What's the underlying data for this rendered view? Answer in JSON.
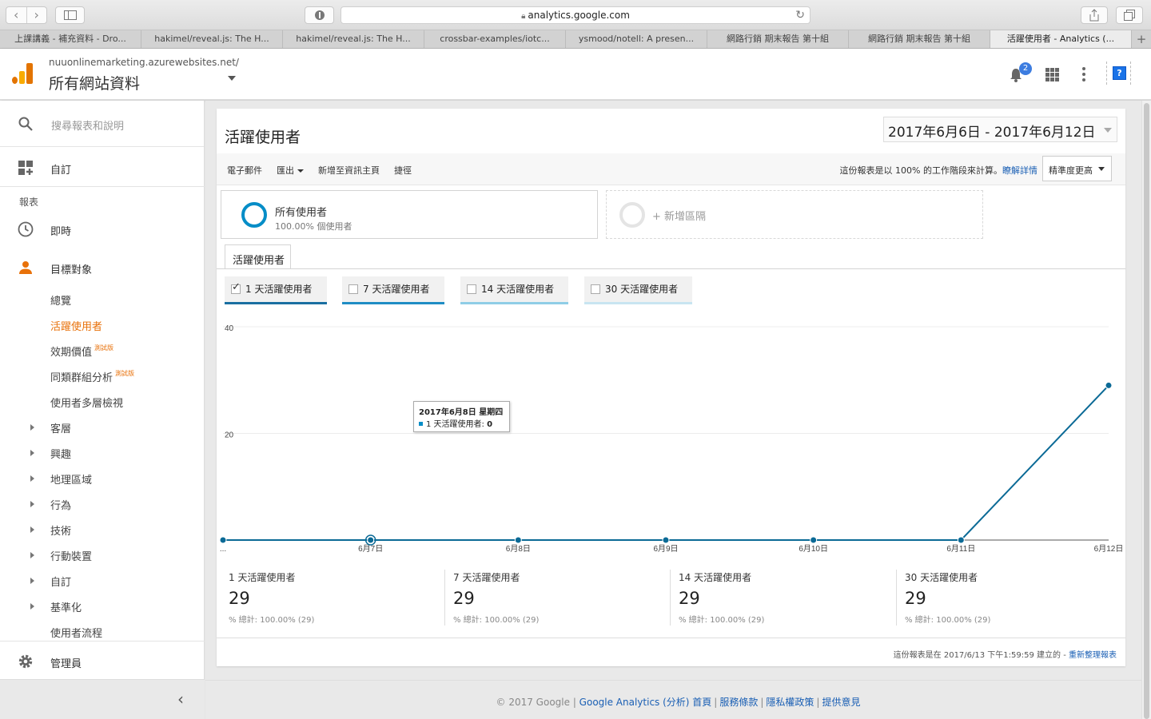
{
  "browser": {
    "url": "analytics.google.com",
    "tabs": [
      "上課講義 - 補充資料 - Dro...",
      "hakimel/reveal.js: The H...",
      "hakimel/reveal.js: The H...",
      "crossbar-examples/iotc...",
      "ysmood/notell: A presen...",
      "網路行銷 期末報告 第十組",
      "網路行銷 期末報告 第十組",
      "活躍使用者 - Analytics (..."
    ],
    "active_tab_index": 7,
    "new_tab": "+"
  },
  "header": {
    "property_domain": "nuuonlinemarketing.azurewebsites.net/",
    "property_name": "所有網站資料",
    "notification_count": "2",
    "help_label": "?"
  },
  "sidebar": {
    "search_placeholder": "搜尋報表和說明",
    "customize": "自訂",
    "reports_label": "報表",
    "realtime": "即時",
    "audience": "目標對象",
    "audience_items": [
      {
        "label": "總覽",
        "badge": ""
      },
      {
        "label": "活躍使用者",
        "badge": ""
      },
      {
        "label": "效期價值",
        "badge": "測試版"
      },
      {
        "label": "同類群組分析",
        "badge": "測試版"
      },
      {
        "label": "使用者多層檢視",
        "badge": ""
      }
    ],
    "expandable_items": [
      "客層",
      "興趣",
      "地理區域",
      "行為",
      "技術",
      "行動裝置",
      "自訂",
      "基準化"
    ],
    "user_flow": "使用者流程",
    "admin": "管理員",
    "collapse": "‹"
  },
  "report": {
    "title": "活躍使用者",
    "date_range": "2017年6月6日 - 2017年6月12日",
    "actions": {
      "email": "電子郵件",
      "export": "匯出",
      "add_dashboard": "新增至資訊主頁",
      "shortcut": "捷徑"
    },
    "sampling_text": "這份報表是以 100% 的工作階段來計算。",
    "sampling_link": "瞭解詳情",
    "precision": "精準度更高",
    "segment_name": "所有使用者",
    "segment_sub": "100.00% 個使用者",
    "add_segment": "+ 新增區隔",
    "view_tab": "活躍使用者",
    "metrics": [
      {
        "label": "1 天活躍使用者",
        "checked": true,
        "color": "#1a6fa1"
      },
      {
        "label": "7 天活躍使用者",
        "checked": false,
        "color": "#1f8dc4"
      },
      {
        "label": "14 天活躍使用者",
        "checked": false,
        "color": "#8fcde6"
      },
      {
        "label": "30 天活躍使用者",
        "checked": false,
        "color": "#c8e5f1"
      }
    ],
    "tooltip": {
      "date": "2017年6月8日 星期四",
      "series_label": "1 天活躍使用者: ",
      "series_value": "0"
    },
    "stats": [
      {
        "label": "1 天活躍使用者",
        "value": "29",
        "sub": "% 總計: 100.00% (29)"
      },
      {
        "label": "7 天活躍使用者",
        "value": "29",
        "sub": "% 總計: 100.00% (29)"
      },
      {
        "label": "14 天活躍使用者",
        "value": "29",
        "sub": "% 總計: 100.00% (29)"
      },
      {
        "label": "30 天活躍使用者",
        "value": "29",
        "sub": "% 總計: 100.00% (29)"
      }
    ],
    "created_text": "這份報表是在 2017/6/13 下午1:59:59 建立的 - ",
    "refresh_link": "重新整理報表"
  },
  "chart_data": {
    "type": "line",
    "categories": [
      "...",
      "6月7日",
      "6月8日",
      "6月9日",
      "6月10日",
      "6月11日",
      "6月12日"
    ],
    "series": [
      {
        "name": "1 天活躍使用者",
        "values": [
          0,
          0,
          0,
          0,
          0,
          0,
          29
        ]
      }
    ],
    "yticks": [
      20,
      40
    ],
    "ylim": [
      0,
      40
    ],
    "series_color": "#0b6a96"
  },
  "footer": {
    "copyright": "© 2017 Google | ",
    "links": [
      "Google Analytics (分析) 首頁",
      "服務條款",
      "隱私權政策",
      "提供意見"
    ]
  }
}
